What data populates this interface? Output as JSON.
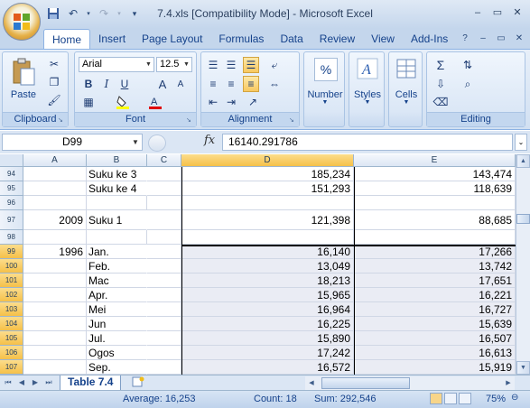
{
  "window": {
    "title": "7.4.xls  [Compatibility Mode] - Microsoft Excel",
    "controls": [
      "–",
      "▭",
      "✕"
    ]
  },
  "quick_access": [
    "save-icon",
    "undo-icon",
    "redo-icon"
  ],
  "ribbon": {
    "tabs": [
      "Home",
      "Insert",
      "Page Layout",
      "Formulas",
      "Data",
      "Review",
      "View",
      "Add-Ins"
    ],
    "active_tab": "Home",
    "groups": {
      "clipboard": {
        "label": "Clipboard",
        "paste": "Paste"
      },
      "font": {
        "label": "Font",
        "font_name": "Arial",
        "font_size": "12.5"
      },
      "alignment": {
        "label": "Alignment"
      },
      "number": {
        "label": "Number",
        "icon": "%"
      },
      "styles": {
        "label": "Styles"
      },
      "cells": {
        "label": "Cells"
      },
      "editing": {
        "label": "Editing"
      }
    }
  },
  "formula_bar": {
    "name_box": "D99",
    "fx": "fx",
    "formula": "16140.291786"
  },
  "grid": {
    "columns": [
      "A",
      "B",
      "C",
      "D",
      "E"
    ],
    "selected_column": "D",
    "rows": [
      {
        "num": "94",
        "a": "",
        "b": "Suku ke 3",
        "d": "185,234",
        "e": "143,474"
      },
      {
        "num": "95",
        "a": "",
        "b": "Suku ke 4",
        "d": "151,293",
        "e": "118,639"
      },
      {
        "num": "96",
        "a": "",
        "b": "",
        "d": "",
        "e": ""
      },
      {
        "num": "97",
        "a": "2009",
        "b": "Suku 1",
        "d": "121,398",
        "e": "88,685"
      },
      {
        "num": "98",
        "a": "",
        "b": "",
        "d": "",
        "e": ""
      },
      {
        "num": "99",
        "a": "1996",
        "b": "Jan.",
        "d": "16,140",
        "e": "17,266"
      },
      {
        "num": "100",
        "a": "",
        "b": "Feb.",
        "d": "13,049",
        "e": "13,742"
      },
      {
        "num": "101",
        "a": "",
        "b": "Mac",
        "d": "18,213",
        "e": "17,651"
      },
      {
        "num": "102",
        "a": "",
        "b": "Apr.",
        "d": "15,965",
        "e": "16,221"
      },
      {
        "num": "103",
        "a": "",
        "b": "Mei",
        "d": "16,964",
        "e": "16,727"
      },
      {
        "num": "104",
        "a": "",
        "b": "Jun",
        "d": "16,225",
        "e": "15,639"
      },
      {
        "num": "105",
        "a": "",
        "b": "Jul.",
        "d": "15,890",
        "e": "16,507"
      },
      {
        "num": "106",
        "a": "",
        "b": "Ogos",
        "d": "17,242",
        "e": "16,613"
      },
      {
        "num": "107",
        "a": "",
        "b": "Sep.",
        "d": "16,572",
        "e": "15,919"
      }
    ]
  },
  "sheet_tabs": [
    "Table 7.4"
  ],
  "status": {
    "average": "Average: 16,253",
    "count": "Count: 18",
    "sum": "Sum: 292,546",
    "zoom": "75%"
  }
}
